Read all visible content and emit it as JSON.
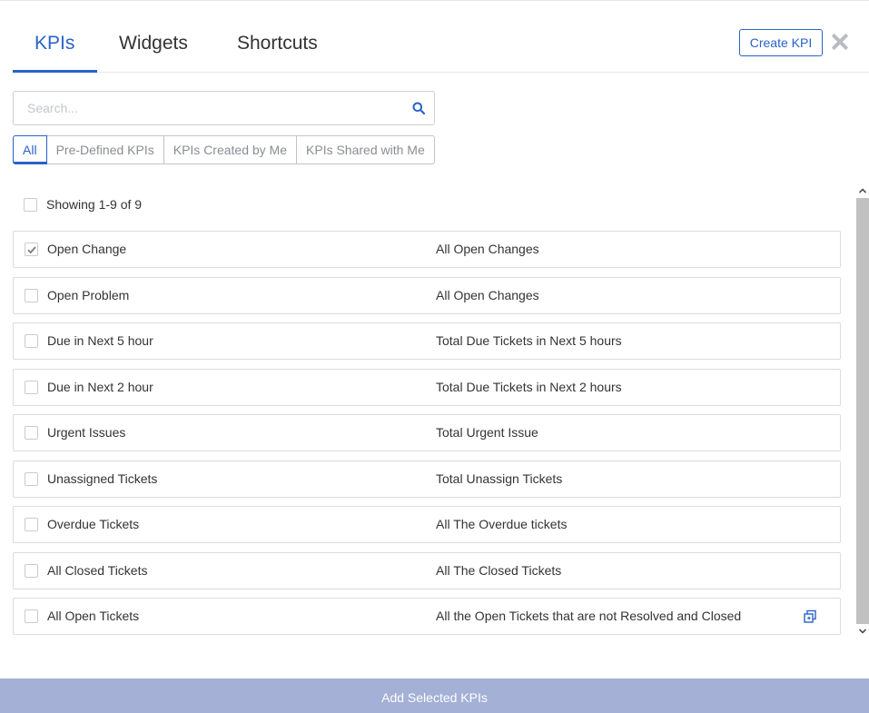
{
  "tabs": [
    {
      "label": "KPIs",
      "active": true
    },
    {
      "label": "Widgets",
      "active": false
    },
    {
      "label": "Shortcuts",
      "active": false
    }
  ],
  "header": {
    "create_button": "Create KPI",
    "close_icon": "close-icon"
  },
  "search": {
    "placeholder": "Search...",
    "value": "",
    "icon": "search-icon"
  },
  "filters": [
    {
      "label": "All",
      "active": true
    },
    {
      "label": "Pre-Defined KPIs",
      "active": false
    },
    {
      "label": "KPIs Created by Me",
      "active": false
    },
    {
      "label": "KPIs Shared with Me",
      "active": false
    }
  ],
  "list": {
    "showing_label": "Showing 1-9 of 9",
    "select_all_checked": false,
    "rows": [
      {
        "name": "Open Change",
        "description": "All Open Changes",
        "checked": true
      },
      {
        "name": "Open Problem",
        "description": "All Open Changes",
        "checked": false
      },
      {
        "name": "Due in Next 5 hour",
        "description": "Total Due Tickets in Next 5 hours",
        "checked": false
      },
      {
        "name": "Due in Next 2 hour",
        "description": "Total Due Tickets in Next 2 hours",
        "checked": false
      },
      {
        "name": "Urgent Issues",
        "description": "Total Urgent Issue",
        "checked": false
      },
      {
        "name": "Unassigned Tickets",
        "description": "Total Unassign Tickets",
        "checked": false
      },
      {
        "name": "Overdue Tickets",
        "description": "All The Overdue tickets",
        "checked": false
      },
      {
        "name": "All Closed Tickets",
        "description": "All The Closed Tickets",
        "checked": false
      },
      {
        "name": "All Open Tickets",
        "description": "All the Open Tickets that are not Resolved and Closed",
        "checked": false,
        "action_icon": "copy-icon"
      }
    ]
  },
  "footer": {
    "add_button": "Add Selected KPIs"
  },
  "colors": {
    "accent": "#2962c8",
    "footer_bg": "#a4b0d6",
    "border": "#dcdcdc",
    "text": "#333333"
  }
}
